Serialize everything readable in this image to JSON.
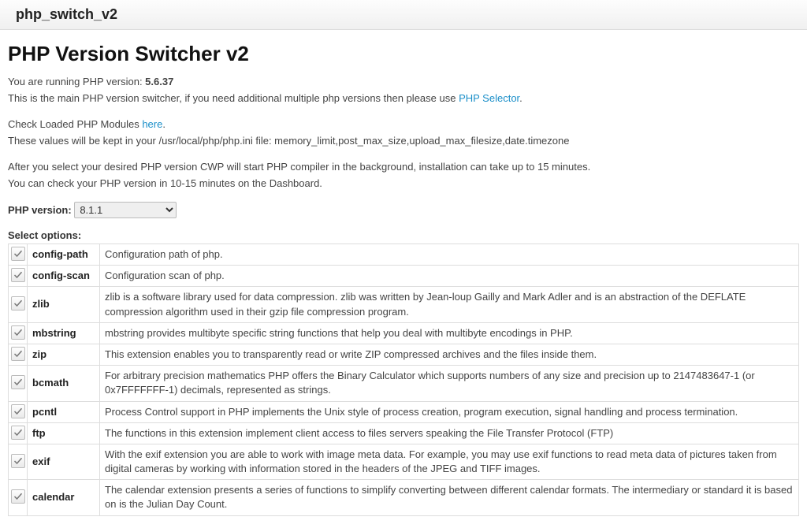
{
  "header": {
    "title": "php_switch_v2"
  },
  "page_title": "PHP Version Switcher v2",
  "intro": {
    "running_prefix": "You are running PHP version: ",
    "running_version": "5.6.37",
    "main_switch_text": "This is the main PHP version switcher, if you need additional multiple php versions then please use ",
    "php_selector_link": "PHP Selector",
    "period": ".",
    "check_modules_prefix": "Check Loaded PHP Modules ",
    "check_modules_link": "here",
    "kept_values": "These values will be kept in your /usr/local/php/php.ini file: memory_limit,post_max_size,upload_max_filesize,date.timezone",
    "compiler_note": "After you select your desired PHP version CWP will start PHP compiler in the background, installation can take up to 15 minutes.",
    "check_version_note": "You can check your PHP version in 10-15 minutes on the Dashboard."
  },
  "version_select": {
    "label": "PHP version:",
    "selected": "8.1.1"
  },
  "options_label": "Select options:",
  "options": [
    {
      "name": "config-path",
      "desc": "Configuration path of php."
    },
    {
      "name": "config-scan",
      "desc": "Configuration scan of php."
    },
    {
      "name": "zlib",
      "desc": "zlib is a software library used for data compression. zlib was written by Jean-loup Gailly and Mark Adler and is an abstraction of the DEFLATE compression algorithm used in their gzip file compression program."
    },
    {
      "name": "mbstring",
      "desc": "mbstring provides multibyte specific string functions that help you deal with multibyte encodings in PHP."
    },
    {
      "name": "zip",
      "desc": "This extension enables you to transparently read or write ZIP compressed archives and the files inside them."
    },
    {
      "name": "bcmath",
      "desc": "For arbitrary precision mathematics PHP offers the Binary Calculator which supports numbers of any size and precision up to 2147483647-1 (or 0x7FFFFFFF-1) decimals, represented as strings."
    },
    {
      "name": "pcntl",
      "desc": "Process Control support in PHP implements the Unix style of process creation, program execution, signal handling and process termination."
    },
    {
      "name": "ftp",
      "desc": "The functions in this extension implement client access to files servers speaking the File Transfer Protocol (FTP)"
    },
    {
      "name": "exif",
      "desc": "With the exif extension you are able to work with image meta data. For example, you may use exif functions to read meta data of pictures taken from digital cameras by working with information stored in the headers of the JPEG and TIFF images."
    },
    {
      "name": "calendar",
      "desc": "The calendar extension presents a series of functions to simplify converting between different calendar formats. The intermediary or standard it is based on is the Julian Day Count."
    }
  ]
}
